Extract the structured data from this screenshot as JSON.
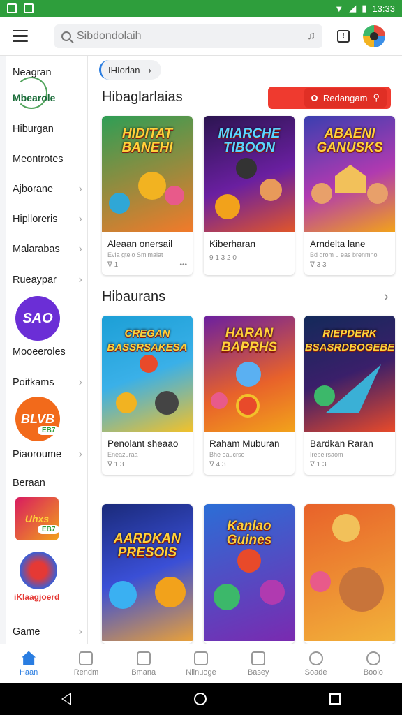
{
  "status_bar": {
    "time": "13:33"
  },
  "search": {
    "placeholder": "Sibdondolaih"
  },
  "sidebar": {
    "items": [
      {
        "label": "Neagran"
      },
      {
        "label": "Mbearole"
      },
      {
        "label": "Hiburgan"
      },
      {
        "label": "Meontrotes"
      },
      {
        "label": "Ajborane"
      },
      {
        "label": "Hiplloreris"
      },
      {
        "label": "Malarabas"
      },
      {
        "label": "Rueaypar"
      },
      {
        "label": "Mooeeroles"
      },
      {
        "label": "Poitkams"
      },
      {
        "label": "Piaoroume"
      },
      {
        "label": "Beraan"
      },
      {
        "label": "Game"
      }
    ],
    "logos": [
      {
        "text": "SAO",
        "color": "#6b2ed6"
      },
      {
        "text": "BLVB",
        "badge": "EB7",
        "color": "#f26a1b"
      },
      {
        "text": "Uhxs",
        "badge": "EB7",
        "color": "#d81b60"
      },
      {
        "text": "iKlaagjoerd",
        "color": "#e53935"
      }
    ]
  },
  "breadcrumb": {
    "label": "IHIorlan"
  },
  "sections": [
    {
      "title": "Hibaglarlaias",
      "button_label": "Redangam",
      "cards": [
        {
          "art_title": "HIDITAT BANEHI",
          "name": "Aleaan onersail",
          "meta": "Evia gtelo  Smimaiat",
          "meta2": "ᐁ 1",
          "meta_dots": "•••",
          "bg": [
            "#2e9e55",
            "#f27a2a"
          ]
        },
        {
          "art_title": "MIARCHE TIBOON",
          "name": "Kiberharan",
          "meta": "",
          "meta2": "9 1 3 2 0",
          "meta_dots": "",
          "bg": [
            "#2b1550",
            "#e0562a"
          ]
        },
        {
          "art_title": "ABAENI GANUSKS",
          "name": "Arndelta lane",
          "meta": "Bd grom u eas brenmnoi",
          "meta2": "ᐁ 3 3",
          "meta_dots": "",
          "bg": [
            "#3a3fb0",
            "#f2a21b"
          ]
        }
      ]
    },
    {
      "title": "Hibaurans",
      "cards": [
        {
          "art_title": "CREGAN BASSRSAKESA",
          "name": "Penolant sheaao",
          "meta": "Eneazuraa",
          "meta2": "ᐁ 1 3",
          "meta_dots": "",
          "bg": [
            "#1c9fd6",
            "#f2c12a"
          ]
        },
        {
          "art_title": "HARAN BAPRHS",
          "name": "Raham Muburan",
          "meta": "Bhe eaucrso",
          "meta2": "ᐁ 4 3",
          "meta_dots": "",
          "bg": [
            "#6a1fa0",
            "#f27a2a"
          ]
        },
        {
          "art_title": "RIEPDERK BSASRDBOGEBE",
          "name": "Bardkan Raran",
          "meta": "Irebeirsaom",
          "meta2": "ᐁ 1 3",
          "meta_dots": "",
          "bg": [
            "#132a5a",
            "#e84a2a"
          ]
        }
      ]
    },
    {
      "cards": [
        {
          "art_title": "AARDKAN PRESOIS",
          "bg": [
            "#1a2a7a",
            "#e8a03a"
          ]
        },
        {
          "art_title": "Kanlao Guines",
          "bg": [
            "#2b6ed6",
            "#7a2ab0"
          ]
        },
        {
          "art_title": "",
          "bg": [
            "#e8622a",
            "#f2b23a"
          ]
        }
      ]
    }
  ],
  "bottom_nav": [
    {
      "label": "Haan",
      "active": true
    },
    {
      "label": "Rendm"
    },
    {
      "label": "Bmana"
    },
    {
      "label": "Nlinuoge"
    },
    {
      "label": "Basey"
    },
    {
      "label": "Soade"
    },
    {
      "label": "Boolo"
    }
  ],
  "colors": {
    "status_bar": "#2e9e3c",
    "accent": "#2a7de1",
    "red_button": "#ef3a2f"
  }
}
